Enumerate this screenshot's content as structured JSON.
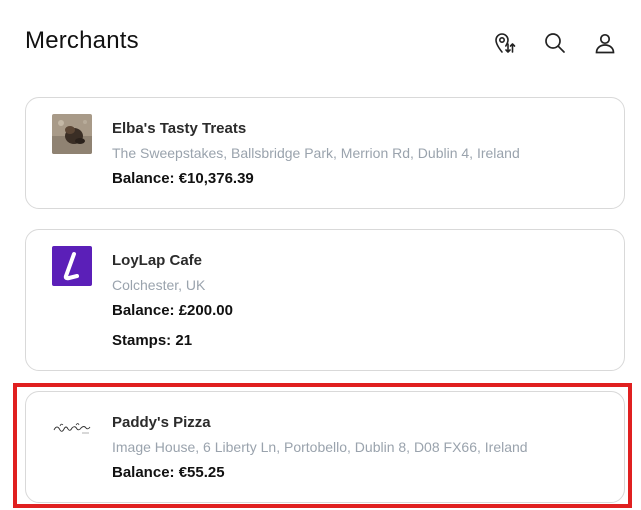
{
  "header": {
    "title": "Merchants",
    "icons": [
      "location-sort-icon",
      "search-icon",
      "user-icon"
    ]
  },
  "merchants": [
    {
      "name": "Elba's Tasty Treats",
      "address": "The Sweepstakes, Ballsbridge Park, Merrion Rd, Dublin 4, Ireland",
      "balance": "Balance: €10,376.39",
      "logo": "dog-photo-logo"
    },
    {
      "name": "LoyLap Cafe",
      "address": "Colchester, UK",
      "balance": "Balance: £200.00",
      "stamps": "Stamps: 21",
      "logo": "loylap-logo",
      "logo_color": "#5b1fb8"
    },
    {
      "name": "Paddy's Pizza",
      "address": "Image House, 6 Liberty Ln, Portobello, Dublin 8, D08 FX66, Ireland",
      "balance": "Balance: €55.25",
      "logo": "script-text-logo",
      "selected": true
    }
  ],
  "colors": {
    "highlight": "#e02020",
    "address_text": "#9aa3ad",
    "card_border": "#d9d9d9"
  }
}
